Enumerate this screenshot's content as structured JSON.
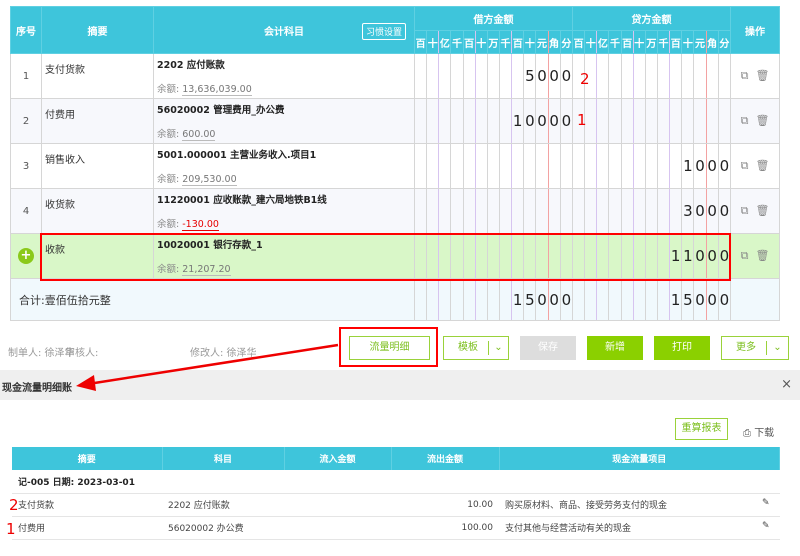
{
  "voucher": {
    "headers": {
      "seq": "序号",
      "summary": "摘要",
      "account": "会计科目",
      "habit_btn": "习惯设置",
      "debit": "借方金额",
      "credit": "贷方金额",
      "ops": "操作"
    },
    "digit_units": [
      "百",
      "十",
      "亿",
      "千",
      "百",
      "十",
      "万",
      "千",
      "百",
      "十",
      "元",
      "角",
      "分"
    ],
    "balance_label": "余额:",
    "rows": [
      {
        "seq": "1",
        "summary": "支付货款",
        "account": "2202 应付账款",
        "balance": "13,636,039.00",
        "negative": false,
        "debit": "5000",
        "credit": ""
      },
      {
        "seq": "2",
        "summary": "付费用",
        "account": "56020002 管理费用_办公费",
        "balance": "600.00",
        "negative": false,
        "debit": "10000",
        "credit": ""
      },
      {
        "seq": "3",
        "summary": "销售收入",
        "account": "5001.000001 主营业务收入.项目1",
        "balance": "209,530.00",
        "negative": false,
        "debit": "",
        "credit": "1000"
      },
      {
        "seq": "4",
        "summary": "收货款",
        "account": "11220001 应收账款_建六局地铁B1线",
        "balance": "-130.00",
        "negative": true,
        "debit": "",
        "credit": "3000"
      },
      {
        "seq": "",
        "summary": "收款",
        "account": "10020001 银行存款_1",
        "balance": "21,207.20",
        "negative": false,
        "debit": "",
        "credit": "11000"
      }
    ],
    "total_label": "合计:壹佰伍拾元整",
    "total_debit": "15000",
    "total_credit": "15000"
  },
  "annotations": {
    "a2": "2",
    "a1": "1",
    "b2": "2",
    "b1": "1"
  },
  "footer": {
    "maker": "制单人: 徐泽华",
    "auditor": "审核人:",
    "modifier": "修改人: 徐泽华"
  },
  "buttons": {
    "cashflow": "流量明细",
    "template": "模板",
    "save": "保存",
    "add": "新增",
    "print": "打印",
    "more": "更多"
  },
  "panel": {
    "title": "现金流量明细账",
    "close": "×",
    "recalc": "重算报表",
    "download": "下载",
    "headers": [
      "摘要",
      "科目",
      "流入金额",
      "流出金额",
      "现金流量项目"
    ],
    "group": "记-005 日期: 2023-03-01",
    "rows": [
      {
        "summary": "支付货款",
        "account": "2202 应付账款",
        "in": "",
        "out": "10.00",
        "item": "购买原材料、商品、接受劳务支付的现金"
      },
      {
        "summary": "付费用",
        "account": "56020002 办公费",
        "in": "",
        "out": "100.00",
        "item": "支付其他与经营活动有关的现金"
      }
    ]
  },
  "colors": {
    "header": "#3ec5db",
    "accent": "#8bd000",
    "selected": "#d9f7c8",
    "red": "#e60000"
  }
}
